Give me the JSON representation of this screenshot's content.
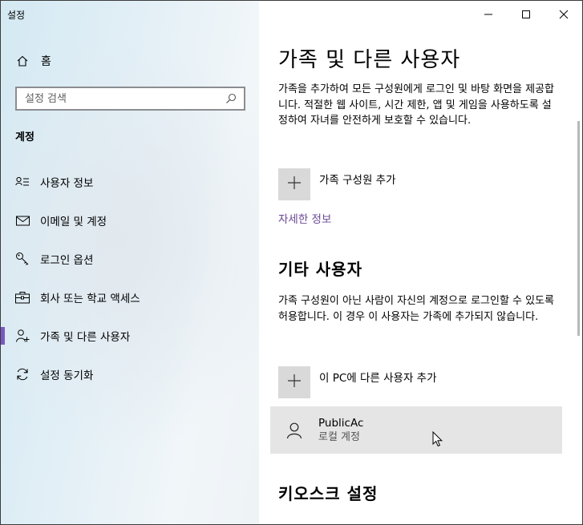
{
  "window": {
    "title": "설정"
  },
  "sidebar": {
    "home_label": "홈",
    "search_placeholder": "설정 검색",
    "section_label": "계정",
    "items": [
      {
        "label": "사용자 정보",
        "icon": "user-info-icon"
      },
      {
        "label": "이메일 및 계정",
        "icon": "mail-icon"
      },
      {
        "label": "로그인 옵션",
        "icon": "key-icon"
      },
      {
        "label": "회사 또는 학교 액세스",
        "icon": "briefcase-icon"
      },
      {
        "label": "가족 및 다른 사용자",
        "icon": "person-add-icon",
        "active": true
      },
      {
        "label": "설정 동기화",
        "icon": "sync-icon"
      }
    ]
  },
  "main": {
    "title": "가족 및 다른 사용자",
    "family_desc": "가족을 추가하여 모든 구성원에게 로그인 및 바탕 화면을 제공합니다. 적절한 웹 사이트, 시간 제한, 앱 및 게임을 사용하도록 설정하여 자녀를 안전하게 보호할 수 있습니다.",
    "add_family_label": "가족 구성원 추가",
    "more_info_link": "자세한 정보",
    "other_users_title": "기타 사용자",
    "other_users_desc": "가족 구성원이 아닌 사람이 자신의 계정으로 로그인할 수 있도록 허용합니다. 이 경우 이 사용자는 가족에 추가되지 않습니다.",
    "add_other_label": "이 PC에 다른 사용자 추가",
    "user": {
      "name": "PublicAc",
      "type": "로컬 계정"
    },
    "kiosk_title": "키오스크 설정"
  },
  "colors": {
    "accent": "#7a58bf",
    "link": "#6a4a93",
    "tile": "#d9d9d9",
    "card": "#e5e5e5"
  }
}
